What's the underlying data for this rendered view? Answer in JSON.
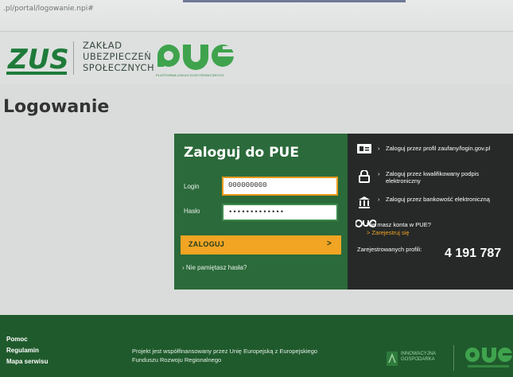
{
  "browser": {
    "url": ".pl/portal/logowanie.npi#"
  },
  "header": {
    "logo_text": "ZUS",
    "org_name": [
      "ZAKŁAD",
      "UBEZPIECZEŃ",
      "SPOŁECZNYCH"
    ],
    "platform_logo": "PUE",
    "platform_tagline": "PLATFORMA USŁUG ELEKTRONICZNYCH"
  },
  "page": {
    "title": "Logowanie"
  },
  "login": {
    "title": "Zaloguj do PUE",
    "login_label": "Login",
    "login_value": "000000000",
    "password_label": "Hasło",
    "password_value": "•••••••••••••",
    "submit_label": "ZALOGUJ",
    "submit_arrow": ">",
    "forgot_link": "Nie pamiętasz hasła?"
  },
  "alt_login": {
    "options": [
      {
        "icon": "id-card-icon",
        "label": "Zaloguj przez profil zaufany/login.gov.pl"
      },
      {
        "icon": "lock-icon",
        "label": "Zaloguj przez kwalifikowany podpis elektroniczny"
      },
      {
        "icon": "bank-icon",
        "label": "Zaloguj przez bankowość elektroniczną"
      }
    ],
    "no_account_text": "Nie masz konta w PUE?",
    "register_link": "> Zarejestruj się",
    "stat_label": "Zarejestrowanych profili:",
    "stat_value": "4 191 787"
  },
  "footer": {
    "links": [
      "Pomoc",
      "Regulamin",
      "Mapa serwisu"
    ],
    "project_text": "Projekt jest współfinansowany przez Unię Europejską z Europejskiego Funduszu Rozwoju Regionalnego",
    "ig_logo_text": "INNOWACYJNA GOSPODARKA",
    "pue_logo": "PUE"
  },
  "colors": {
    "green_dark": "#1f5a2c",
    "green_panel": "#2b6a3a",
    "accent_orange": "#f2a423",
    "dark_panel": "#262928",
    "zus_green": "#1e7b3a"
  }
}
